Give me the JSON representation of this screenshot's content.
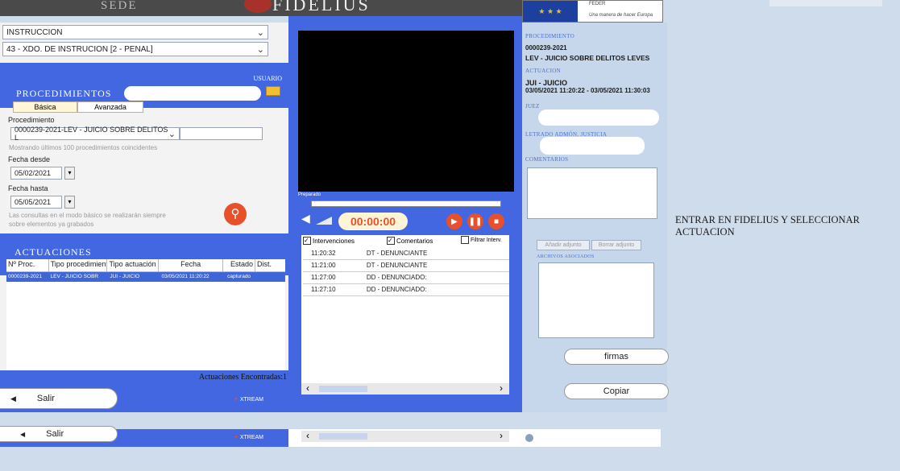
{
  "header": {
    "sede_text": "SEDE",
    "fidelius_logo": "FIDELIUS",
    "eu_caption": "Una manera de hacer Europa",
    "feder_text": "FEDER"
  },
  "left": {
    "instruccion_select": "INSTRUCCION",
    "juzgado_select": "43 - XDO. DE INSTRUCION [2 - PENAL]",
    "usuario_label": "USUARIO",
    "procedimientos_title": "PROCEDIMIENTOS",
    "tabs": [
      "Básica",
      "Avanzada"
    ],
    "procedimiento_label": "Procedimiento",
    "procedimiento_value": "0000239-2021-LEV - JUICIO SOBRE DELITOS L",
    "mostrando_text": "Mostrando últimos 100 procedimientos coincidentes",
    "fecha_desde_label": "Fecha desde",
    "fecha_desde_value": "05/02/2021",
    "fecha_hasta_label": "Fecha hasta",
    "fecha_hasta_value": "05/05/2021",
    "hint_text": "Las consultas en el modo básico se realizarán siempre sobre elementos ya grabados",
    "actuaciones_title": "ACTUACIONES",
    "table_headers": [
      "Nº Proc.",
      "Tipo procedimiento",
      "Tipo actuación",
      "Fecha",
      "Estado",
      "Dist."
    ],
    "table_row": [
      "0000239-2021",
      "LEV - JUICIO SOBR",
      "JUI - JUICIO",
      "03/05/2021 11:20:22",
      "capturado",
      ""
    ],
    "encontradas": "Actuaciones Encontradas:1",
    "salir_label": "Salir",
    "xtream_label": "XTREAM"
  },
  "player": {
    "preparado": "Preparado",
    "timecode": "00:00:00",
    "check_intervenciones": "Intervenciones",
    "check_comentarios": "Comentarios",
    "filtrar_label": "Filtrar Interv.",
    "interventions": [
      {
        "time": "11:20:32",
        "text": "DT - DENUNCIANTE"
      },
      {
        "time": "11:21:00",
        "text": "DT - DENUNCIANTE"
      },
      {
        "time": "11:27:00",
        "text": "DD - DENUNCIADO:"
      },
      {
        "time": "11:27:10",
        "text": "DD - DENUNCIADO:"
      }
    ]
  },
  "details": {
    "procedimiento_label": "PROCEDIMIENTO",
    "procedimiento_num": "0000239-2021",
    "procedimiento_desc": "LEV - JUICIO SOBRE DELITOS LEVES",
    "actuacion_label": "ACTUACION",
    "actuacion_type": "JUI - JUICIO",
    "actuacion_dates": "03/05/2021 11:20:22 - 03/05/2021 11:30:03",
    "juez_label": "JUEZ",
    "letrado_label": "LETRADO ADMÓN. JUSTICIA",
    "comentarios_label": "COMENTARIOS",
    "anadir_adjunto": "Añadir adjunto",
    "borrar_adjunto": "Borrar adjunto",
    "archivos_label": "ARCHIVOS ASOCIADOS",
    "firmas_label": "firmas",
    "copiar_label": "Copiar"
  },
  "instruction": "ENTRAR EN FIDELIUS Y SELECCIONAR ACTUACION"
}
